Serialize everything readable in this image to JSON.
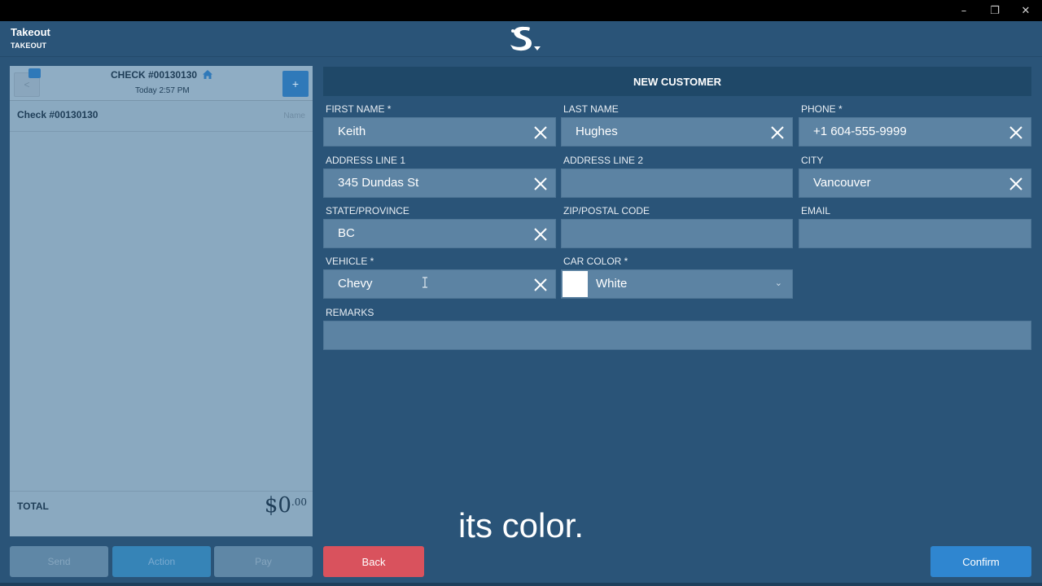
{
  "window": {
    "minimize": "–",
    "restore": "❐",
    "close": "✕"
  },
  "header": {
    "title": "Takeout",
    "subtitle": "TAKEOUT",
    "logo": "S-logo-icon"
  },
  "check": {
    "back": "<",
    "title": "CHECK #00130130",
    "time": "Today 2:57 PM",
    "add": "+",
    "row_label": "Check #00130130",
    "row_name": "Name",
    "total_label": "TOTAL",
    "total_main": "$0",
    "total_cents": ".00"
  },
  "left_buttons": {
    "send": "Send",
    "action": "Action",
    "pay": "Pay"
  },
  "form": {
    "heading": "NEW CUSTOMER",
    "first_name": {
      "label": "FIRST NAME *",
      "value": "Keith"
    },
    "last_name": {
      "label": "LAST NAME",
      "value": "Hughes"
    },
    "phone": {
      "label": "PHONE *",
      "value": "+1 604-555-9999"
    },
    "address1": {
      "label": "ADDRESS LINE 1",
      "value": "345 Dundas St"
    },
    "address2": {
      "label": "ADDRESS LINE 2",
      "value": ""
    },
    "city": {
      "label": "CITY",
      "value": "Vancouver"
    },
    "state": {
      "label": "STATE/PROVINCE",
      "value": "BC"
    },
    "zip": {
      "label": "ZIP/POSTAL CODE",
      "value": ""
    },
    "email": {
      "label": "EMAIL",
      "value": ""
    },
    "vehicle": {
      "label": "VEHICLE *",
      "value": "Chevy"
    },
    "car_color": {
      "label": "CAR COLOR *",
      "value": "White",
      "swatch": "#ffffff"
    },
    "remarks": {
      "label": "REMARKS",
      "value": ""
    }
  },
  "buttons": {
    "back": "Back",
    "confirm": "Confirm"
  },
  "caption": "its color.",
  "colors": {
    "background": "#2a5478",
    "back_button": "#d9525d",
    "confirm_button": "#2f86d0"
  }
}
